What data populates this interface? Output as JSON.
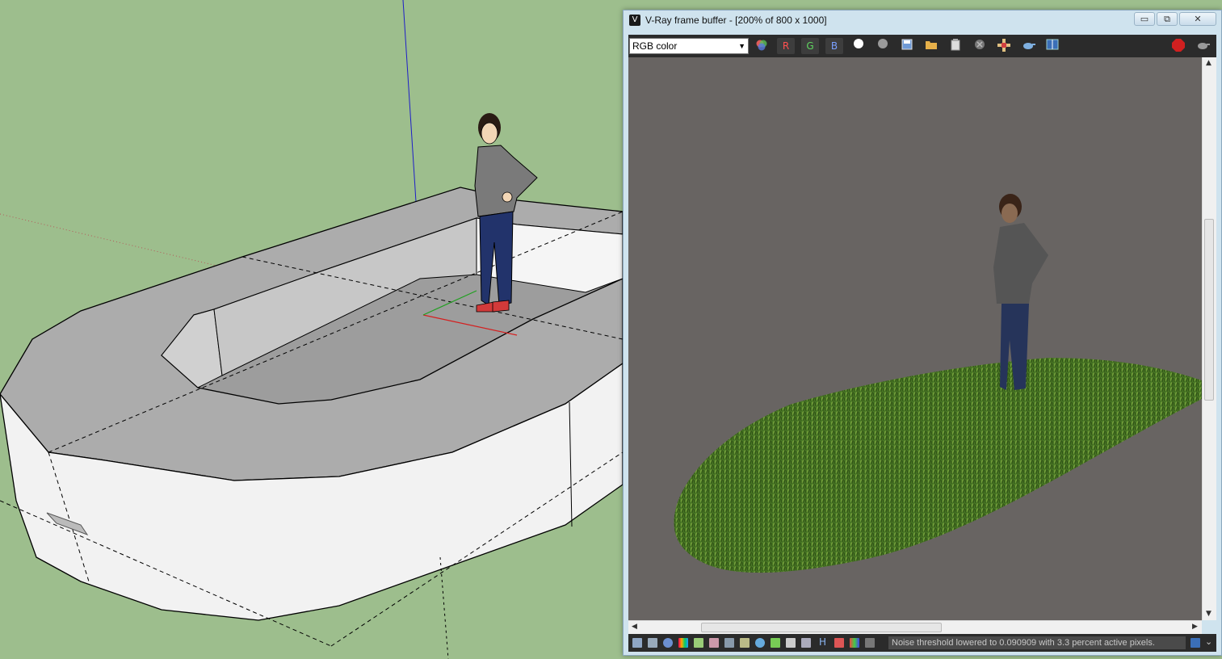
{
  "viewport": {
    "name": "SketchUp 3D model view"
  },
  "vfb": {
    "title": "V-Ray frame buffer - [200% of 800 x 1000]",
    "window_buttons": {
      "minimize": "▭",
      "restore": "⧉",
      "close": "✕"
    },
    "channel_select": {
      "value": "RGB color"
    },
    "toolbar": {
      "r": "R",
      "g": "G",
      "b": "B"
    },
    "status_text": "Noise threshold lowered to 0.090909 with 3.3 percent active pixels.",
    "status_letter_h": "H"
  },
  "colors": {
    "viewport_bg": "#9dbe8d",
    "render_bg": "#686462",
    "toolbar_bg": "#2b2b2b",
    "grass": "#3f6a21"
  }
}
